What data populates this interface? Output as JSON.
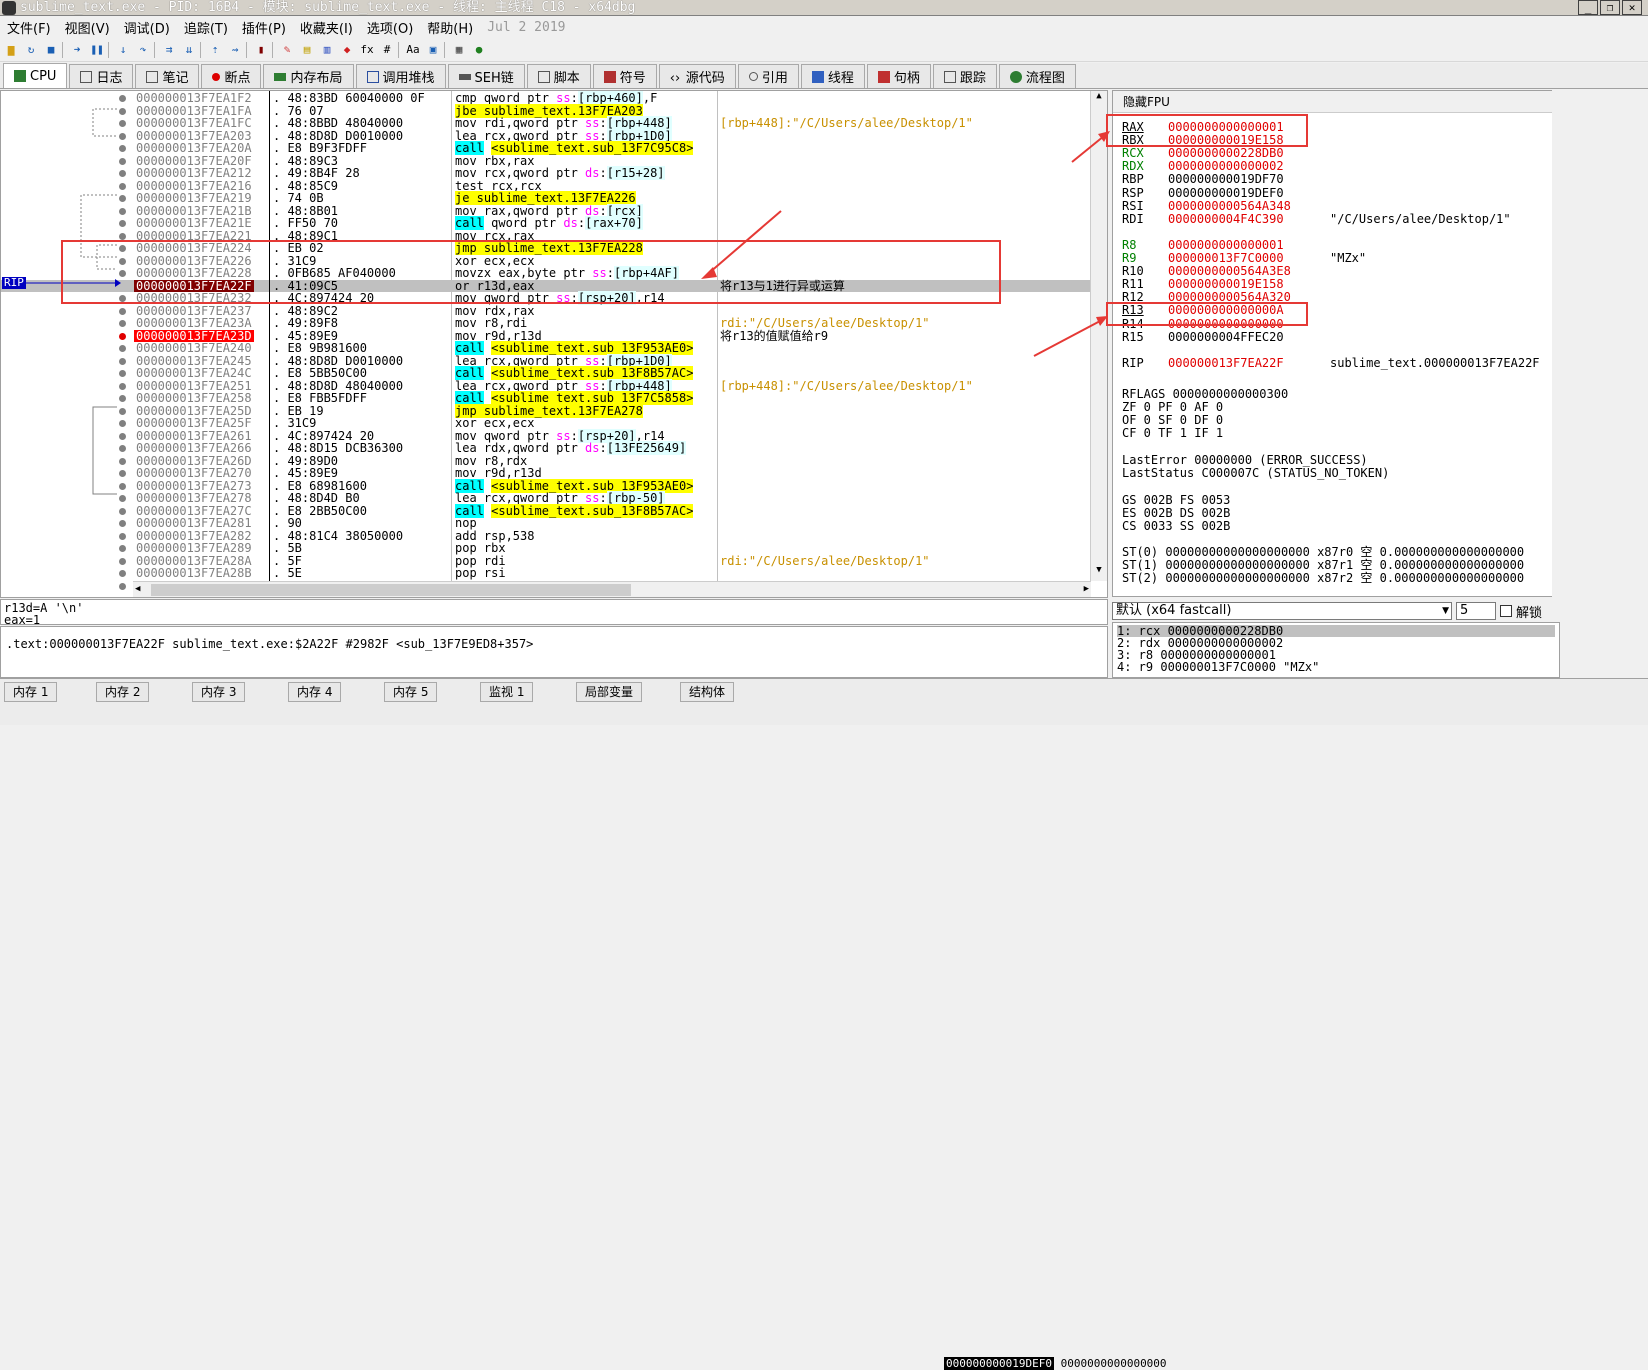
{
  "titlebar": {
    "title": "sublime_text.exe - PID: 16B4 - 模块: sublime_text.exe - 线程: 主线程 C18 - x64dbg"
  },
  "menu": {
    "items": [
      "文件(F)",
      "视图(V)",
      "调试(D)",
      "追踪(T)",
      "插件(P)",
      "收藏夹(I)",
      "选项(O)",
      "帮助(H)"
    ],
    "date": "Jul 2 2019"
  },
  "tabs": [
    "CPU",
    "日志",
    "笔记",
    "断点",
    "内存布局",
    "调用堆栈",
    "SEH链",
    "脚本",
    "符号",
    "源代码",
    "引用",
    "线程",
    "句柄",
    "跟踪",
    "流程图"
  ],
  "disasm": [
    {
      "addr": "000000013F7EA1F2",
      "bytes": "48:83BD 60040000 0F",
      "ins": "cmp qword ptr ss:[rbp+460],F",
      "cmt": ""
    },
    {
      "addr": "000000013F7EA1FA",
      "bytes": "76 07",
      "ins": "jbe sublime_text.13F7EA203",
      "cmt": ""
    },
    {
      "addr": "000000013F7EA1FC",
      "bytes": "48:8BBD 48040000",
      "ins": "mov rdi,qword ptr ss:[rbp+448]",
      "cmt": "[rbp+448]:\"/C/Users/alee/Desktop/1\""
    },
    {
      "addr": "000000013F7EA203",
      "bytes": "48:8D8D D0010000",
      "ins": "lea rcx,qword ptr ss:[rbp+1D0]",
      "cmt": ""
    },
    {
      "addr": "000000013F7EA20A",
      "bytes": "E8 B9F3FDFF",
      "ins": "call <sublime_text.sub_13F7C95C8>",
      "cmt": ""
    },
    {
      "addr": "000000013F7EA20F",
      "bytes": "48:89C3",
      "ins": "mov rbx,rax",
      "cmt": ""
    },
    {
      "addr": "000000013F7EA212",
      "bytes": "49:8B4F 28",
      "ins": "mov rcx,qword ptr ds:[r15+28]",
      "cmt": ""
    },
    {
      "addr": "000000013F7EA216",
      "bytes": "48:85C9",
      "ins": "test rcx,rcx",
      "cmt": ""
    },
    {
      "addr": "000000013F7EA219",
      "bytes": "74 0B",
      "ins": "je sublime_text.13F7EA226",
      "cmt": ""
    },
    {
      "addr": "000000013F7EA21B",
      "bytes": "48:8B01",
      "ins": "mov rax,qword ptr ds:[rcx]",
      "cmt": ""
    },
    {
      "addr": "000000013F7EA21E",
      "bytes": "FF50 70",
      "ins": "call qword ptr ds:[rax+70]",
      "cmt": ""
    },
    {
      "addr": "000000013F7EA221",
      "bytes": "48:89C1",
      "ins": "mov rcx,rax",
      "cmt": ""
    },
    {
      "addr": "000000013F7EA224",
      "bytes": "EB 02",
      "ins": "jmp sublime_text.13F7EA228",
      "cmt": ""
    },
    {
      "addr": "000000013F7EA226",
      "bytes": "31C9",
      "ins": "xor ecx,ecx",
      "cmt": ""
    },
    {
      "addr": "000000013F7EA228",
      "bytes": "0FB685 AF040000",
      "ins": "movzx eax,byte ptr ss:[rbp+4AF]",
      "cmt": ""
    },
    {
      "addr": "000000013F7EA22F",
      "bytes": "41:09C5",
      "ins": "or r13d,eax",
      "cmt": "将r13与1进行异或运算"
    },
    {
      "addr": "000000013F7EA232",
      "bytes": "4C:897424 20",
      "ins": "mov qword ptr ss:[rsp+20],r14",
      "cmt": ""
    },
    {
      "addr": "000000013F7EA237",
      "bytes": "48:89C2",
      "ins": "mov rdx,rax",
      "cmt": ""
    },
    {
      "addr": "000000013F7EA23A",
      "bytes": "49:89F8",
      "ins": "mov r8,rdi",
      "cmt": "rdi:\"/C/Users/alee/Desktop/1\""
    },
    {
      "addr": "000000013F7EA23D",
      "bytes": "45:89E9",
      "ins": "mov r9d,r13d",
      "cmt": "将r13的值赋值给r9"
    },
    {
      "addr": "000000013F7EA240",
      "bytes": "E8 9B981600",
      "ins": "call <sublime_text.sub_13F953AE0>",
      "cmt": ""
    },
    {
      "addr": "000000013F7EA245",
      "bytes": "48:8D8D D0010000",
      "ins": "lea rcx,qword ptr ss:[rbp+1D0]",
      "cmt": ""
    },
    {
      "addr": "000000013F7EA24C",
      "bytes": "E8 5BB50C00",
      "ins": "call <sublime_text.sub_13F8B57AC>",
      "cmt": ""
    },
    {
      "addr": "000000013F7EA251",
      "bytes": "48:8D8D 48040000",
      "ins": "lea rcx,qword ptr ss:[rbp+448]",
      "cmt": "[rbp+448]:\"/C/Users/alee/Desktop/1\""
    },
    {
      "addr": "000000013F7EA258",
      "bytes": "E8 FBB5FDFF",
      "ins": "call <sublime_text.sub_13F7C5858>",
      "cmt": ""
    },
    {
      "addr": "000000013F7EA25D",
      "bytes": "EB 19",
      "ins": "jmp sublime_text.13F7EA278",
      "cmt": ""
    },
    {
      "addr": "000000013F7EA25F",
      "bytes": "31C9",
      "ins": "xor ecx,ecx",
      "cmt": ""
    },
    {
      "addr": "000000013F7EA261",
      "bytes": "4C:897424 20",
      "ins": "mov qword ptr ss:[rsp+20],r14",
      "cmt": ""
    },
    {
      "addr": "000000013F7EA266",
      "bytes": "48:8D15 DCB36300",
      "ins": "lea rdx,qword ptr ds:[13FE25649]",
      "cmt": ""
    },
    {
      "addr": "000000013F7EA26D",
      "bytes": "49:89D0",
      "ins": "mov r8,rdx",
      "cmt": ""
    },
    {
      "addr": "000000013F7EA270",
      "bytes": "45:89E9",
      "ins": "mov r9d,r13d",
      "cmt": ""
    },
    {
      "addr": "000000013F7EA273",
      "bytes": "E8 68981600",
      "ins": "call <sublime_text.sub_13F953AE0>",
      "cmt": ""
    },
    {
      "addr": "000000013F7EA278",
      "bytes": "48:8D4D B0",
      "ins": "lea rcx,qword ptr ss:[rbp-50]",
      "cmt": ""
    },
    {
      "addr": "000000013F7EA27C",
      "bytes": "E8 2BB50C00",
      "ins": "call <sublime_text.sub_13F8B57AC>",
      "cmt": ""
    },
    {
      "addr": "000000013F7EA281",
      "bytes": "90",
      "ins": "nop",
      "cmt": ""
    },
    {
      "addr": "000000013F7EA282",
      "bytes": "48:81C4 38050000",
      "ins": "add rsp,538",
      "cmt": ""
    },
    {
      "addr": "000000013F7EA289",
      "bytes": "5B",
      "ins": "pop rbx",
      "cmt": ""
    },
    {
      "addr": "000000013F7EA28A",
      "bytes": "5F",
      "ins": "pop rdi",
      "cmt": "rdi:\"/C/Users/alee/Desktop/1\""
    },
    {
      "addr": "000000013F7EA28B",
      "bytes": "5E",
      "ins": "pop rsi",
      "cmt": ""
    },
    {
      "addr": "000000013F7EA28C",
      "bytes": "41:5C",
      "ins": "pop r12",
      "cmt": ""
    }
  ],
  "rip_label": "RIP",
  "regs": {
    "header": "隐藏FPU",
    "items": [
      {
        "n": "RAX",
        "v": "0000000000000001",
        "c": "",
        "ul": true,
        "vc": "red"
      },
      {
        "n": "RBX",
        "v": "000000000019E158",
        "c": "",
        "ul": true,
        "vc": "red"
      },
      {
        "n": "RCX",
        "v": "0000000000228DB0",
        "c": "",
        "nc": "green",
        "vc": "red"
      },
      {
        "n": "RDX",
        "v": "0000000000000002",
        "c": "",
        "nc": "green",
        "vc": "red"
      },
      {
        "n": "RBP",
        "v": "000000000019DF70",
        "c": ""
      },
      {
        "n": "RSP",
        "v": "000000000019DEF0",
        "c": ""
      },
      {
        "n": "RSI",
        "v": "0000000000564A348",
        "c": "",
        "vc": "red"
      },
      {
        "n": "RDI",
        "v": "0000000004F4C390",
        "c": "\"/C/Users/alee/Desktop/1\"",
        "vc": "red"
      },
      {
        "n": "",
        "v": "",
        "c": ""
      },
      {
        "n": "R8",
        "v": "0000000000000001",
        "c": "",
        "nc": "green",
        "vc": "red"
      },
      {
        "n": "R9",
        "v": "000000013F7C0000",
        "c": "\"MZx\"",
        "nc": "green",
        "vc": "red"
      },
      {
        "n": "R10",
        "v": "0000000000564A3E8",
        "c": "",
        "vc": "red"
      },
      {
        "n": "R11",
        "v": "000000000019E158",
        "c": "",
        "vc": "red"
      },
      {
        "n": "R12",
        "v": "0000000000564A320",
        "c": "",
        "vc": "red"
      },
      {
        "n": "R13",
        "v": "000000000000000A",
        "c": "",
        "ul": true,
        "vc": "red"
      },
      {
        "n": "R14",
        "v": "0000000000000000",
        "c": "",
        "vc": "red"
      },
      {
        "n": "R15",
        "v": "0000000004FFEC20",
        "c": ""
      },
      {
        "n": "",
        "v": "",
        "c": ""
      },
      {
        "n": "RIP",
        "v": "000000013F7EA22F",
        "c": "sublime_text.000000013F7EA22F",
        "vc": "red"
      }
    ],
    "rflags": "RFLAGS   0000000000000300",
    "flags1": "ZF 0  PF 0  AF 0",
    "flags2": "OF 0  SF 0  DF 0",
    "flags3": "CF 0  TF 1  IF 1",
    "lasterror": "LastError  00000000 (ERROR_SUCCESS)",
    "laststatus": "LastStatus C000007C (STATUS_NO_TOKEN)",
    "seg1": "GS 002B  FS 0053",
    "seg2": "ES 002B  DS 002B",
    "seg3": "CS 0033  SS 002B",
    "st0": "ST(0) 00000000000000000000 x87r0 空 0.000000000000000000",
    "st1": "ST(1) 00000000000000000000 x87r1 空 0.000000000000000000",
    "st2": "ST(2) 00000000000000000000 x87r2 空 0.000000000000000000"
  },
  "info": {
    "l1": "r13d=A '\\n'",
    "l2": "eax=1"
  },
  "addrline": ".text:000000013F7EA22F sublime_text.exe:$2A22F #2982F <sub_13F7E9ED8+357>",
  "callconv": {
    "value": "默认 (x64 fastcall)",
    "spin": "5",
    "lock": "解锁"
  },
  "args": [
    "1: rcx 0000000000228DB0",
    "2: rdx 0000000000000002",
    "3: r8 0000000000000001",
    "4: r9 000000013F7C0000 \"MZx\""
  ],
  "bottomtabs": [
    "内存 1",
    "内存 2",
    "内存 3",
    "内存 4",
    "内存 5",
    "监视 1",
    "局部变量",
    "结构体"
  ],
  "status": {
    "a": "000000000019DEF0",
    "b": "0000000000000000"
  }
}
